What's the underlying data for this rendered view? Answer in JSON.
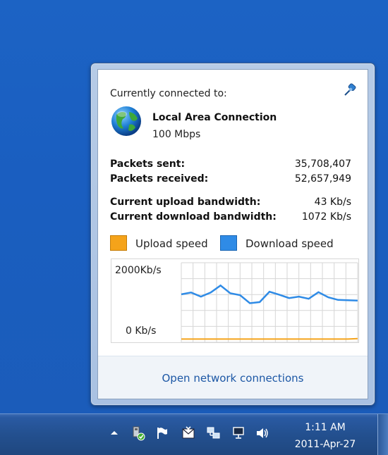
{
  "flyout": {
    "header": "Currently connected to:",
    "connection_name": "Local Area Connection",
    "connection_speed": "100 Mbps",
    "stats": {
      "packets_sent_label": "Packets sent:",
      "packets_sent_value": "35,708,407",
      "packets_received_label": "Packets received:",
      "packets_received_value": "52,657,949",
      "upload_bw_label": "Current upload bandwidth:",
      "upload_bw_value": "43 Kb/s",
      "download_bw_label": "Current download bandwidth:",
      "download_bw_value": "1072 Kb/s"
    },
    "legend": {
      "upload_label": "Upload speed",
      "download_label": "Download speed",
      "upload_color": "#f5a31a",
      "download_color": "#2f8be6"
    },
    "graph": {
      "max_label": "2000Kb/s",
      "min_label": "0 Kb/s"
    },
    "footer_link": "Open network connections"
  },
  "chart_data": {
    "type": "line",
    "ylim": [
      0,
      2000
    ],
    "series": [
      {
        "name": "Upload speed",
        "values": [
          30,
          30,
          30,
          30,
          30,
          30,
          30,
          30,
          30,
          30,
          30,
          30,
          30,
          30,
          30,
          30,
          30,
          30,
          43
        ]
      },
      {
        "name": "Download speed",
        "values": [
          1240,
          1290,
          1180,
          1290,
          1480,
          1270,
          1220,
          1000,
          1030,
          1310,
          1230,
          1140,
          1180,
          1120,
          1300,
          1160,
          1090,
          1080,
          1072
        ]
      }
    ]
  },
  "taskbar": {
    "time": "1:11 AM",
    "date": "2011-Apr-27",
    "tray_icons": [
      "show-hidden-icons-icon",
      "safely-remove-hardware-icon",
      "action-center-flag-icon",
      "mail-icon",
      "network-icon",
      "display-icon",
      "volume-icon"
    ]
  }
}
